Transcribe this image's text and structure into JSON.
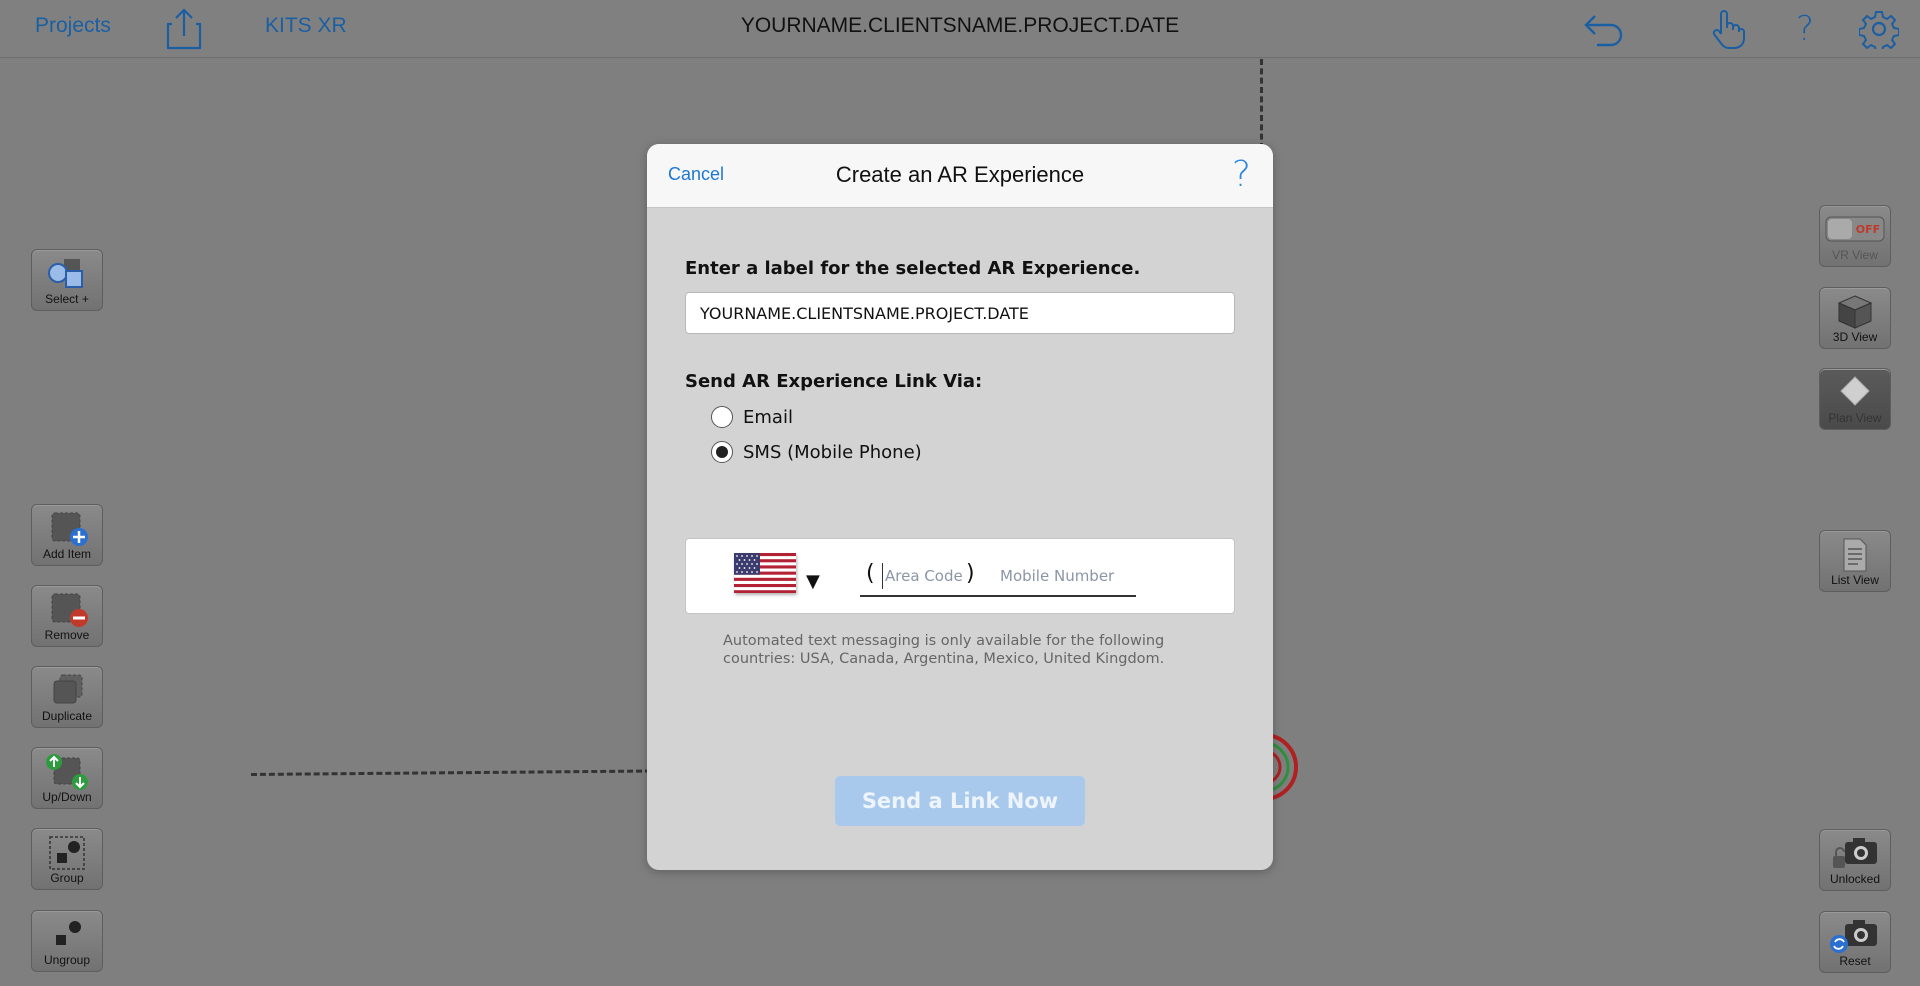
{
  "topbar": {
    "projects_label": "Projects",
    "kits_label": "KITS XR",
    "title": "YOURNAME.CLIENTSNAME.PROJECT.DATE",
    "icons": [
      "share-icon",
      "undo-icon",
      "touch-icon",
      "help-icon",
      "settings-icon"
    ],
    "accent_color": "#1b5fa3"
  },
  "left_tools": [
    {
      "label": "Select +",
      "icon": "select-shapes-icon"
    },
    {
      "label": "Add Item",
      "icon": "add-item-icon"
    },
    {
      "label": "Remove",
      "icon": "remove-item-icon"
    },
    {
      "label": "Duplicate",
      "icon": "duplicate-icon"
    },
    {
      "label": "Up/Down",
      "icon": "up-down-icon"
    },
    {
      "label": "Group",
      "icon": "group-icon"
    },
    {
      "label": "Ungroup",
      "icon": "ungroup-icon"
    }
  ],
  "right_tools": [
    {
      "label": "VR View",
      "icon": "vr-toggle-icon",
      "badge": "OFF"
    },
    {
      "label": "3D View",
      "icon": "cube-icon"
    },
    {
      "label": "Plan View",
      "icon": "plan-view-icon"
    },
    {
      "label": "List View",
      "icon": "document-list-icon"
    },
    {
      "label": "Unlocked",
      "icon": "camera-unlocked-icon"
    },
    {
      "label": "Reset",
      "icon": "camera-reset-icon"
    }
  ],
  "modal": {
    "cancel_label": "Cancel",
    "title": "Create an AR Experience",
    "help_label": "?",
    "label_heading": "Enter a label for the selected AR Experience.",
    "label_value": "YOURNAME.CLIENTSNAME.PROJECT.DATE",
    "send_heading": "Send AR Experience Link Via:",
    "options": [
      {
        "label": "Email",
        "selected": false
      },
      {
        "label": "SMS (Mobile Phone)",
        "selected": true
      }
    ],
    "phone": {
      "country": "USA",
      "caret": "▼",
      "open_paren": "(",
      "close_paren": ")",
      "area_placeholder": "Area Code",
      "mobile_placeholder": "Mobile Number"
    },
    "note": "Automated text messaging is only available for the following countries: USA, Canada, Argentina, Mexico, United Kingdom.",
    "send_button": "Send a Link Now",
    "send_button_color": "#a9c9ec"
  }
}
